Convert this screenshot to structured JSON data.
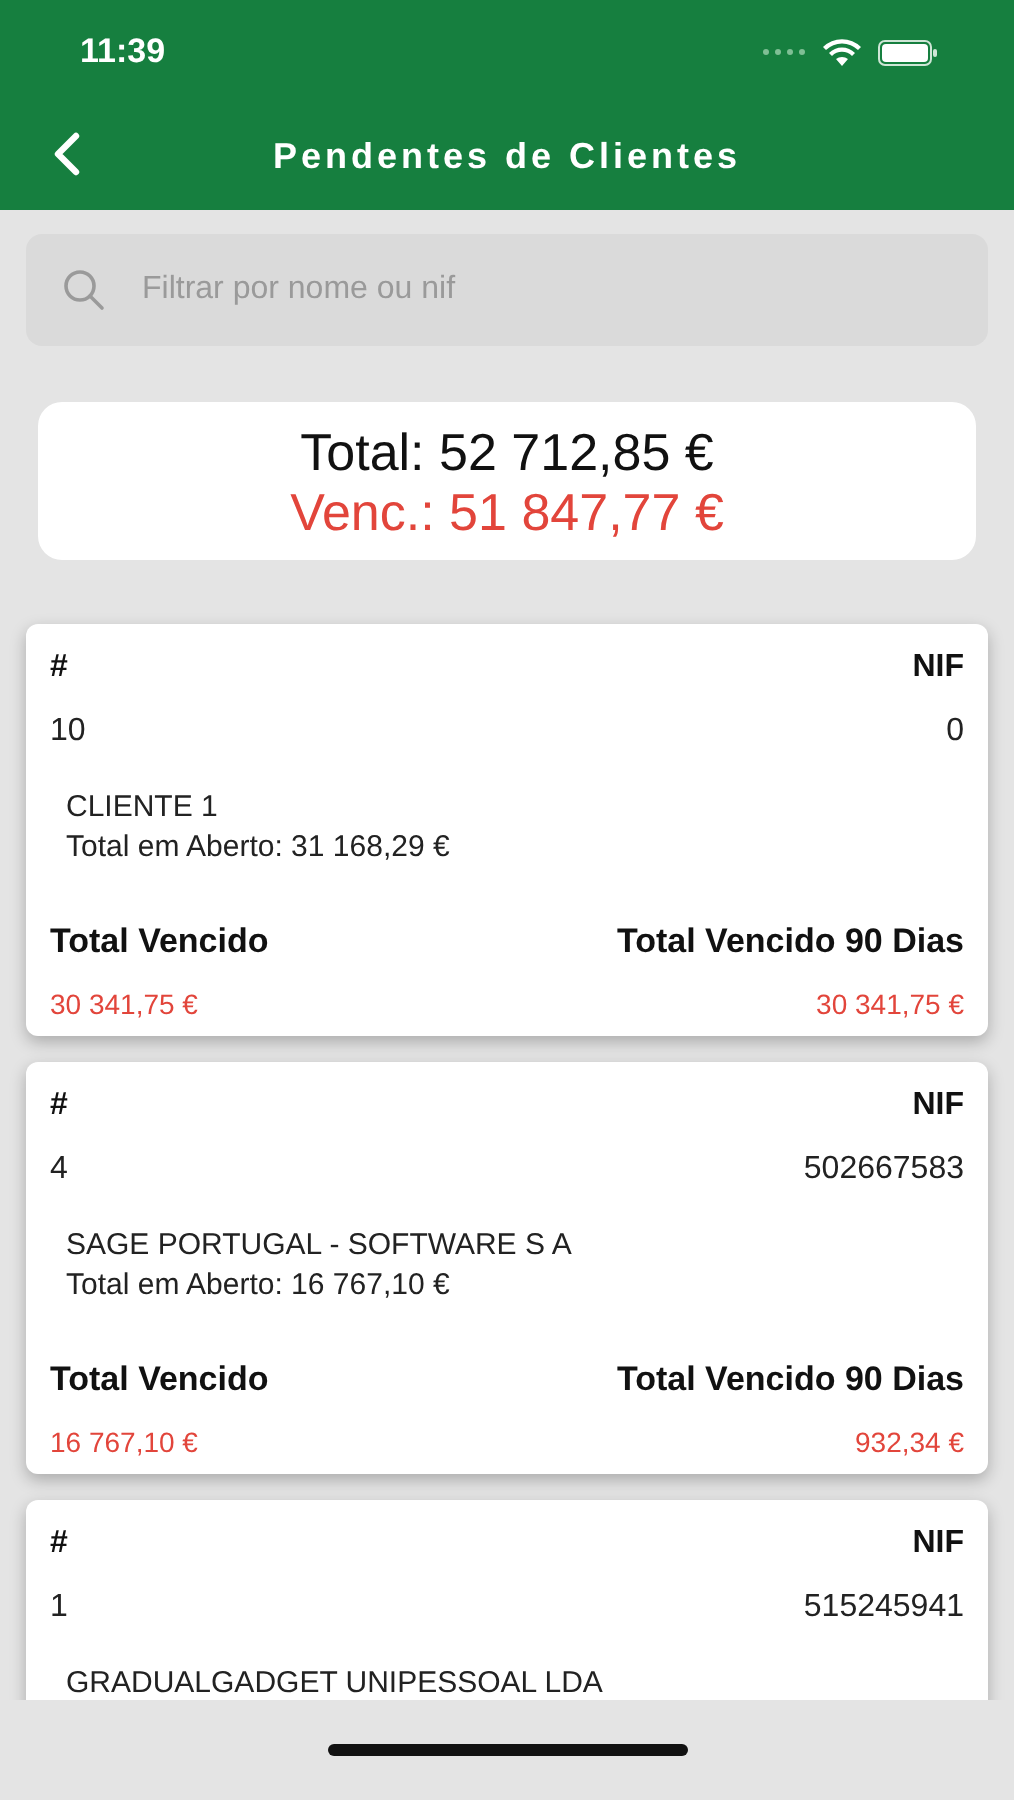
{
  "status_bar": {
    "time": "11:39"
  },
  "header": {
    "title": "Pendentes de Clientes"
  },
  "search": {
    "placeholder": "Filtrar por nome ou nif"
  },
  "summary": {
    "total": "Total: 52 712,85 €",
    "overdue": "Venc.: 51 847,77 €"
  },
  "clients": [
    {
      "number_label": "#",
      "nif_label": "NIF",
      "number": "10",
      "nif": "0",
      "name": "CLIENTE 1",
      "open_total": "Total em Aberto: 31 168,29 €",
      "overdue_label": "Total Vencido",
      "overdue_90_label": "Total Vencido 90 Dias",
      "overdue": "30 341,75 €",
      "overdue_90": "30 341,75 €"
    },
    {
      "number_label": "#",
      "nif_label": "NIF",
      "number": "4",
      "nif": "502667583",
      "name": "SAGE PORTUGAL - SOFTWARE S A",
      "open_total": "Total em Aberto: 16 767,10 €",
      "overdue_label": "Total Vencido",
      "overdue_90_label": "Total Vencido 90 Dias",
      "overdue": "16 767,10 €",
      "overdue_90": "932,34 €"
    },
    {
      "number_label": "#",
      "nif_label": "NIF",
      "number": "1",
      "nif": "515245941",
      "name": "GRADUALGADGET UNIPESSOAL LDA"
    }
  ]
}
